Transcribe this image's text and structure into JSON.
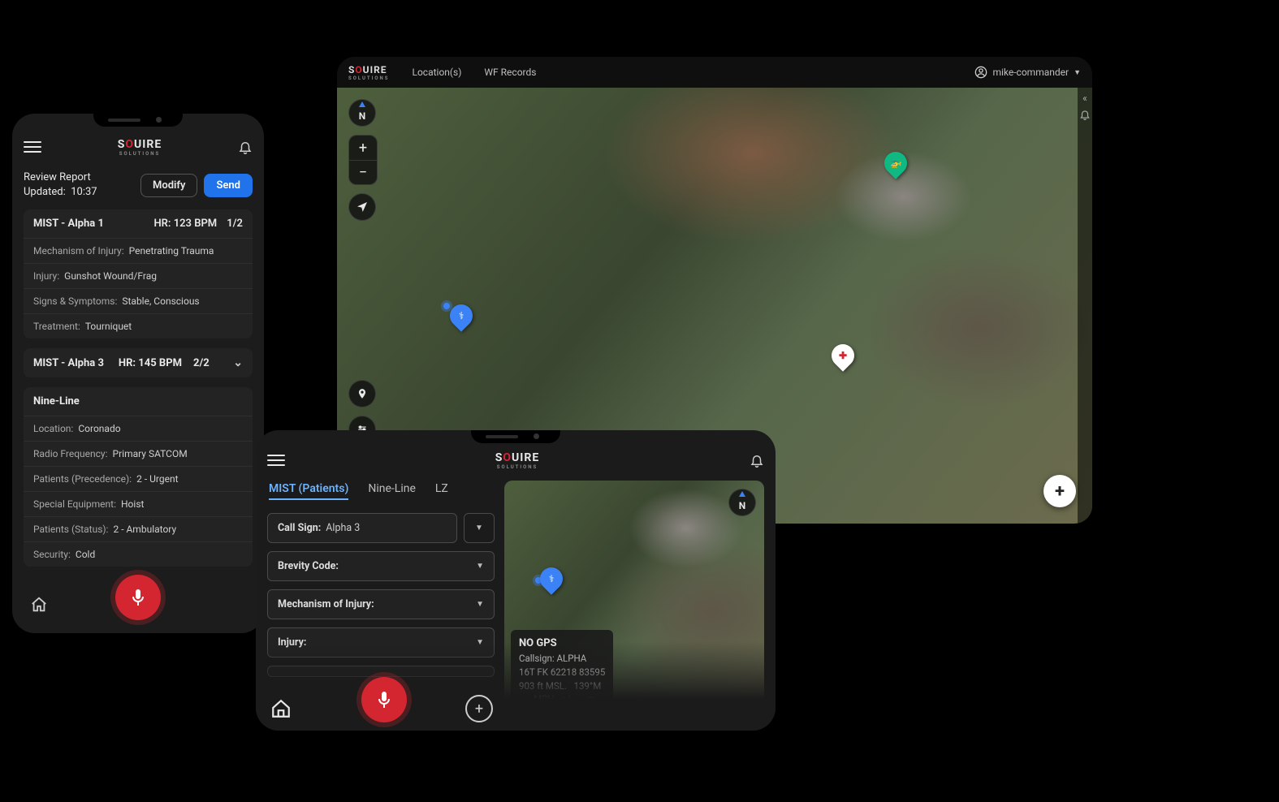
{
  "brand": {
    "name_pre": "S",
    "name_hl": "O",
    "name_post": "UIRE",
    "subtitle": "SOLUTIONS"
  },
  "desktop": {
    "nav": {
      "locations": "Location(s)",
      "wfrecords": "WF Records"
    },
    "user": "mike-commander",
    "compass": "N",
    "markers": {
      "blue": "⚕",
      "white": "✚",
      "green": "🚁"
    }
  },
  "phone1": {
    "review_title": "Review Report",
    "updated_label": "Updated:",
    "updated_time": "10:37",
    "modify": "Modify",
    "send": "Send",
    "mist1": {
      "title": "MIST - Alpha 1",
      "hr": "HR: 123 BPM",
      "count": "1/2",
      "rows": [
        {
          "label": "Mechanism of Injury:",
          "value": "Penetrating Trauma"
        },
        {
          "label": "Injury:",
          "value": "Gunshot Wound/Frag"
        },
        {
          "label": "Signs & Symptoms:",
          "value": "Stable, Conscious"
        },
        {
          "label": "Treatment:",
          "value": "Tourniquet"
        }
      ]
    },
    "mist3": {
      "title": "MIST - Alpha 3",
      "hr": "HR: 145 BPM",
      "count": "2/2"
    },
    "nineline": {
      "title": "Nine-Line",
      "rows": [
        {
          "label": "Location:",
          "value": "Coronado"
        },
        {
          "label": "Radio Frequency:",
          "value": "Primary SATCOM"
        },
        {
          "label": "Patients (Precedence):",
          "value": "2 - Urgent"
        },
        {
          "label": "Special Equipment:",
          "value": "Hoist"
        },
        {
          "label": "Patients (Status):",
          "value": "2 - Ambulatory"
        },
        {
          "label": "Security:",
          "value": "Cold"
        }
      ]
    }
  },
  "phone2": {
    "tabs": {
      "mist": "MIST (Patients)",
      "nineline": "Nine-Line",
      "lz": "LZ"
    },
    "form": {
      "callsign_label": "Call Sign:",
      "callsign_value": "Alpha 3",
      "brevity": "Brevity Code:",
      "mechanism": "Mechanism of Injury:",
      "injury": "Injury:"
    },
    "info": {
      "title": "NO GPS",
      "callsign": "Callsign: ALPHA",
      "grid": "16T FK 62218 83595",
      "elev": "903 ft MSL.   139°M",
      "speed": "- - - MPH   +/- - - -m"
    },
    "compass": "N"
  }
}
